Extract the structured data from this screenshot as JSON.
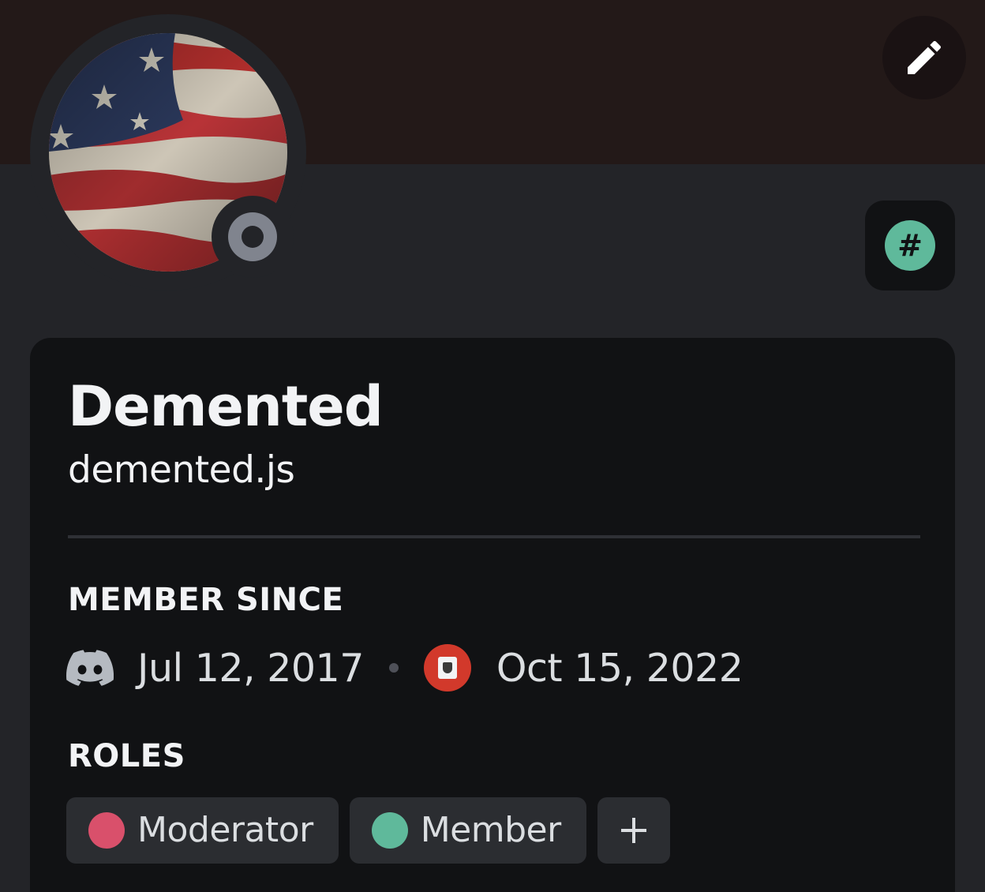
{
  "profile": {
    "display_name": "Demented",
    "username": "demented.js",
    "status": "offline",
    "badge_symbol": "#"
  },
  "member_since": {
    "title": "MEMBER SINCE",
    "discord_date": "Jul 12, 2017",
    "server_date": "Oct 15, 2022"
  },
  "roles": {
    "title": "ROLES",
    "items": [
      {
        "label": "Moderator",
        "color": "#d9506b"
      },
      {
        "label": "Member",
        "color": "#5fb99b"
      }
    ],
    "add_symbol": "+"
  },
  "colors": {
    "banner": "#231918",
    "background": "#232428",
    "card": "#111214",
    "pill": "#2b2d31",
    "status_offline": "#80848e",
    "badge": "#5fb99b"
  },
  "icons": {
    "edit": "pencil-icon",
    "discord": "discord-logo-icon",
    "server": "server-icon",
    "add": "plus-icon"
  }
}
